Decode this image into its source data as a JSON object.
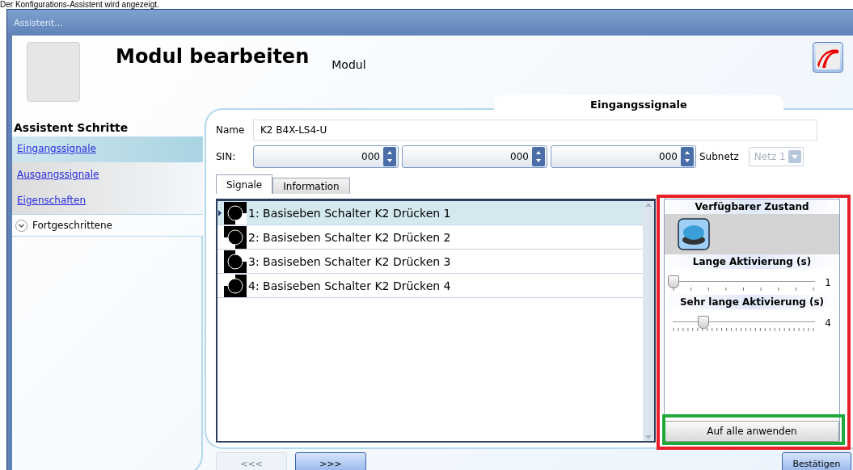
{
  "caption": "Der Konfigurations-Assistent wird angezeigt.",
  "window": {
    "title": "Assistent..."
  },
  "header": {
    "title": "Modul bearbeiten",
    "subtitle": "Modul",
    "step_tab": "Eingangssignale"
  },
  "sidebar": {
    "title": "Assistent Schritte",
    "items": [
      {
        "label": "Eingangssignale",
        "selected": true
      },
      {
        "label": "Ausgangssignale",
        "selected": false
      },
      {
        "label": "Eigenschaften",
        "selected": false
      }
    ],
    "expander": {
      "label": "Fortgeschrittene",
      "expanded": false
    }
  },
  "form": {
    "name_label": "Name",
    "name_value": "K2 B4X-LS4-U",
    "sin_label": "SIN:",
    "sin_values": [
      "000",
      "000",
      "000"
    ],
    "subnet_label": "Subnetz",
    "subnet_value": "Netz 1",
    "subnet_disabled": true
  },
  "tabs": [
    {
      "label": "Signale",
      "selected": true
    },
    {
      "label": "Information",
      "selected": false
    }
  ],
  "signals": [
    {
      "label": "1: Basiseben Schalter K2 Drücken 1",
      "selected": true
    },
    {
      "label": "2: Basiseben Schalter K2 Drücken 2",
      "selected": false
    },
    {
      "label": "3: Basiseben Schalter K2 Drücken 3",
      "selected": false
    },
    {
      "label": "4: Basiseben Schalter K2 Drücken 4",
      "selected": false
    }
  ],
  "properties": {
    "state_title": "Verfügbarer Zustand",
    "sliders": [
      {
        "title": "Lange Aktivierung (s)",
        "level": 0,
        "reading": "1"
      },
      {
        "title": "Sehr lange Aktivierung (s)",
        "level": 0.22,
        "reading": "4"
      }
    ],
    "apply_button": "Auf alle anwenden"
  },
  "footer": {
    "back": "<<<",
    "back_disabled": true,
    "next": ">>>",
    "next_disabled": false,
    "confirm": "Bestätigen"
  }
}
